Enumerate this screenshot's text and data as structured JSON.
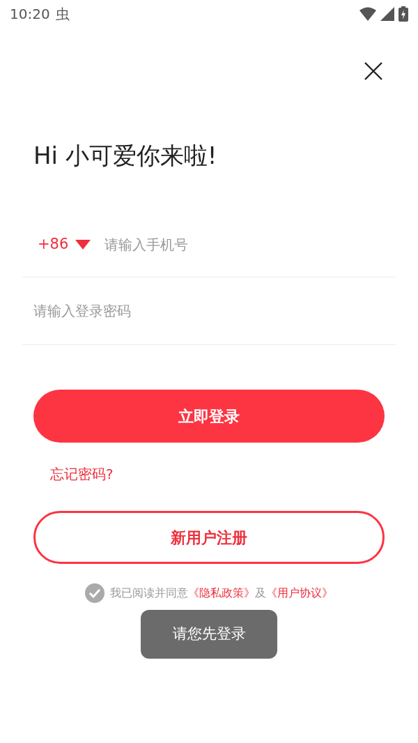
{
  "status_bar": {
    "time": "10:20",
    "notification": "虫"
  },
  "greeting": "Hi 小可爱你来啦!",
  "phone": {
    "country_code": "+86",
    "placeholder": "请输入手机号"
  },
  "password": {
    "placeholder": "请输入登录密码"
  },
  "login_button": "立即登录",
  "forgot_password": "忘记密码?",
  "register_button": "新用户注册",
  "agreement": {
    "checked": false,
    "text": "我已阅读并同意",
    "privacy_link": "《隐私政策》",
    "joiner": "及",
    "terms_link": "《用户协议》"
  },
  "toast": "请您先登录"
}
